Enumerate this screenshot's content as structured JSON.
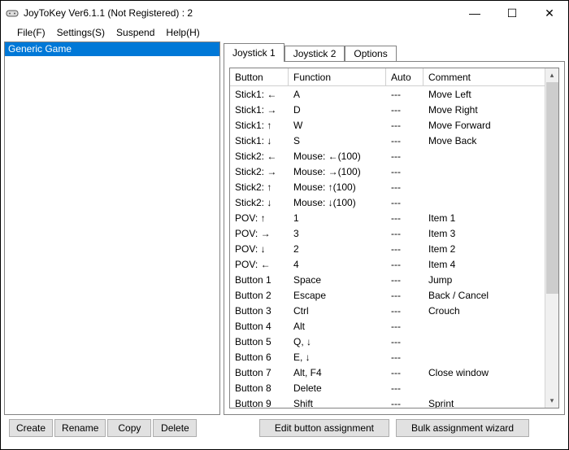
{
  "title": "JoyToKey Ver6.1.1 (Not Registered) : 2",
  "menu": {
    "file": "File(F)",
    "settings": "Settings(S)",
    "suspend": "Suspend",
    "help": "Help(H)"
  },
  "profiles": [
    "Generic Game"
  ],
  "tabs": {
    "t0": "Joystick 1",
    "t1": "Joystick 2",
    "t2": "Options"
  },
  "headers": {
    "button": "Button",
    "function": "Function",
    "auto": "Auto",
    "comment": "Comment"
  },
  "rows": [
    {
      "button": "Stick1: ←",
      "func": "A",
      "auto": "---",
      "comment": "Move Left"
    },
    {
      "button": "Stick1: →",
      "func": "D",
      "auto": "---",
      "comment": "Move Right"
    },
    {
      "button": "Stick1: ↑",
      "func": "W",
      "auto": "---",
      "comment": "Move Forward"
    },
    {
      "button": "Stick1: ↓",
      "func": "S",
      "auto": "---",
      "comment": "Move Back"
    },
    {
      "button": "Stick2: ←",
      "func": "Mouse: ←(100)",
      "auto": "---",
      "comment": ""
    },
    {
      "button": "Stick2: →",
      "func": "Mouse: →(100)",
      "auto": "---",
      "comment": ""
    },
    {
      "button": "Stick2: ↑",
      "func": "Mouse: ↑(100)",
      "auto": "---",
      "comment": ""
    },
    {
      "button": "Stick2: ↓",
      "func": "Mouse: ↓(100)",
      "auto": "---",
      "comment": ""
    },
    {
      "button": "POV: ↑",
      "func": "1",
      "auto": "---",
      "comment": "Item 1"
    },
    {
      "button": "POV: →",
      "func": "3",
      "auto": "---",
      "comment": "Item 3"
    },
    {
      "button": "POV: ↓",
      "func": "2",
      "auto": "---",
      "comment": "Item 2"
    },
    {
      "button": "POV: ←",
      "func": "4",
      "auto": "---",
      "comment": "Item 4"
    },
    {
      "button": "Button 1",
      "func": "Space",
      "auto": "---",
      "comment": "Jump"
    },
    {
      "button": "Button 2",
      "func": "Escape",
      "auto": "---",
      "comment": "Back / Cancel"
    },
    {
      "button": "Button 3",
      "func": "Ctrl",
      "auto": "---",
      "comment": "Crouch"
    },
    {
      "button": "Button 4",
      "func": "Alt",
      "auto": "---",
      "comment": ""
    },
    {
      "button": "Button 5",
      "func": "Q, ↓",
      "auto": "---",
      "comment": ""
    },
    {
      "button": "Button 6",
      "func": "E, ↓",
      "auto": "---",
      "comment": ""
    },
    {
      "button": "Button 7",
      "func": "Alt, F4",
      "auto": "---",
      "comment": "Close window"
    },
    {
      "button": "Button 8",
      "func": "Delete",
      "auto": "---",
      "comment": ""
    },
    {
      "button": "Button 9",
      "func": "Shift",
      "auto": "---",
      "comment": "Sprint"
    }
  ],
  "leftButtons": {
    "create": "Create",
    "rename": "Rename",
    "copy": "Copy",
    "delete": "Delete"
  },
  "rightButtons": {
    "edit": "Edit button assignment",
    "bulk": "Bulk assignment wizard"
  }
}
